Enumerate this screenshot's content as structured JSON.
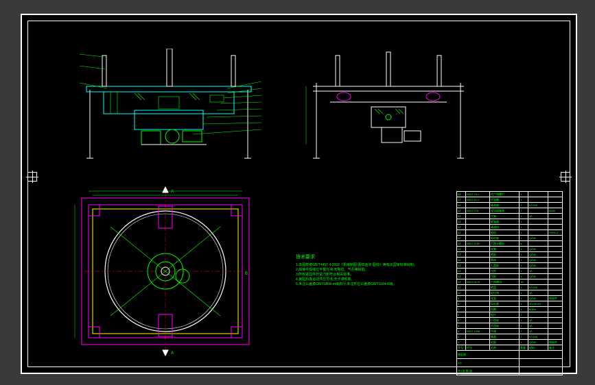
{
  "notes_title": "技术要求",
  "notes": [
    "1.本图样按GB/T4457.4-2002《机械制图 图样画法 图线》等有关国家标准绘制。",
    "2.焊接件焊缝应平整光滑,无裂纹、气孔等缺陷。",
    "3.所有紧固件拧紧力矩符合相关标准。",
    "4.装配后各运动件应灵活,无卡滞现象。",
    "5.未注公差按GB/T1804-m级执行,未注形位公差按GB/T1184-K级。"
  ],
  "bom_headers": [
    "序号",
    "代号",
    "名称",
    "数量",
    "材料",
    "备注"
  ],
  "bom": [
    {
      "no": "28",
      "code": "GB/T 70.1",
      "name": "内六角螺钉",
      "qty": "4",
      "mat": "",
      "rem": ""
    },
    {
      "no": "27",
      "code": "GB/T 97.1",
      "name": "平垫圈",
      "qty": "4",
      "mat": "",
      "rem": ""
    },
    {
      "no": "26",
      "code": "",
      "name": "轴承座",
      "qty": "2",
      "mat": "HT200",
      "rem": ""
    },
    {
      "no": "25",
      "code": "GB/T 276",
      "name": "深沟球轴承",
      "qty": "2",
      "mat": "",
      "rem": "6205"
    },
    {
      "no": "24",
      "code": "",
      "name": "主轴",
      "qty": "1",
      "mat": "45",
      "rem": ""
    },
    {
      "no": "23",
      "code": "",
      "name": "联轴器",
      "qty": "1",
      "mat": "",
      "rem": ""
    },
    {
      "no": "22",
      "code": "",
      "name": "减速机",
      "qty": "1",
      "mat": "",
      "rem": ""
    },
    {
      "no": "21",
      "code": "",
      "name": "电机",
      "qty": "1",
      "mat": "",
      "rem": "Y90S-4"
    },
    {
      "no": "20",
      "code": "",
      "name": "电机座",
      "qty": "1",
      "mat": "Q235",
      "rem": ""
    },
    {
      "no": "19",
      "code": "GB/T 5782",
      "name": "六角头螺栓",
      "qty": "8",
      "mat": "",
      "rem": ""
    },
    {
      "no": "18",
      "code": "",
      "name": "支腿",
      "qty": "4",
      "mat": "Q235",
      "rem": ""
    },
    {
      "no": "17",
      "code": "",
      "name": "底板",
      "qty": "1",
      "mat": "Q235",
      "rem": ""
    },
    {
      "no": "16",
      "code": "",
      "name": "筒体",
      "qty": "1",
      "mat": "Q235",
      "rem": ""
    },
    {
      "no": "15",
      "code": "",
      "name": "上盖板",
      "qty": "1",
      "mat": "Q235",
      "rem": ""
    },
    {
      "no": "14",
      "code": "",
      "name": "立柱",
      "qty": "4",
      "mat": "45",
      "rem": ""
    },
    {
      "no": "13",
      "code": "",
      "name": "压板",
      "qty": "4",
      "mat": "Q235",
      "rem": ""
    },
    {
      "no": "12",
      "code": "GB/T 6170",
      "name": "六角螺母",
      "qty": "16",
      "mat": "",
      "rem": ""
    },
    {
      "no": "11",
      "code": "",
      "name": "转盘",
      "qty": "1",
      "mat": "HT200",
      "rem": ""
    },
    {
      "no": "10",
      "code": "",
      "name": "定位销",
      "qty": "4",
      "mat": "45",
      "rem": ""
    },
    {
      "no": "9",
      "code": "",
      "name": "支架",
      "qty": "1",
      "mat": "Q235",
      "rem": "焊接件"
    },
    {
      "no": "8",
      "code": "",
      "name": "导向套",
      "qty": "4",
      "mat": "ZCuSn10",
      "rem": ""
    },
    {
      "no": "7",
      "code": "",
      "name": "挡圈",
      "qty": "4",
      "mat": "65Mn",
      "rem": ""
    },
    {
      "no": "6",
      "code": "",
      "name": "垫片",
      "qty": "2",
      "mat": "",
      "rem": ""
    },
    {
      "no": "5",
      "code": "",
      "name": "小齿轮",
      "qty": "1",
      "mat": "45",
      "rem": ""
    },
    {
      "no": "4",
      "code": "",
      "name": "大齿轮",
      "qty": "1",
      "mat": "45",
      "rem": ""
    },
    {
      "no": "3",
      "code": "GB/T 1096",
      "name": "平键",
      "qty": "2",
      "mat": "45",
      "rem": ""
    },
    {
      "no": "2",
      "code": "",
      "name": "端盖",
      "qty": "2",
      "mat": "HT150",
      "rem": ""
    },
    {
      "no": "1",
      "code": "",
      "name": "机架",
      "qty": "1",
      "mat": "Q235",
      "rem": "焊接件"
    }
  ],
  "title_block": {
    "drawing_name": "装配图",
    "drawing_no": "",
    "scale": "1:5",
    "sheet": "共1张 第1张",
    "designer": "",
    "checker": "",
    "approver": "",
    "date": ""
  },
  "dims": {
    "top_outer": "",
    "section": "A",
    "detail": "B"
  }
}
